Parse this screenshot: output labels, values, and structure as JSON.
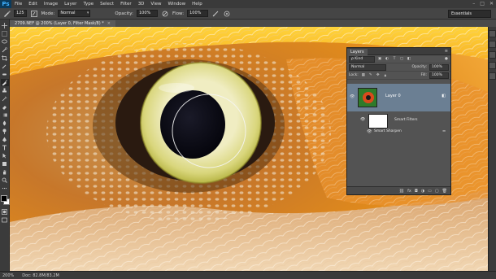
{
  "app": {
    "logo": "Ps",
    "menu": [
      "File",
      "Edit",
      "Image",
      "Layer",
      "Type",
      "Select",
      "Filter",
      "3D",
      "View",
      "Window",
      "Help"
    ],
    "window_controls": [
      "–",
      "□",
      "✕"
    ]
  },
  "options_bar": {
    "brush_size": "125",
    "mode_label": "Mode:",
    "mode_value": "Normal",
    "opacity_label": "Opacity:",
    "opacity_value": "100%",
    "flow_label": "Flow:",
    "flow_value": "100%",
    "workspace": "Essentials"
  },
  "document": {
    "tab_title": "2709.NEF @ 200% (Layer 0, Filter Mask/8) *",
    "close": "×"
  },
  "status_bar": {
    "zoom": "200%",
    "doc_info": "Doc: 82.8M/83.2M"
  },
  "layers_panel": {
    "tab": "Layers",
    "menu_icon": "≡",
    "filter_kind": "ρ Kind",
    "blend_mode": "Normal",
    "opacity_label": "Opacity:",
    "opacity_value": "100%",
    "lock_label": "Lock:",
    "fill_label": "Fill:",
    "fill_value": "100%",
    "layer_name": "Layer 0",
    "smart_filters_label": "Smart Filters",
    "filter_name": "Smart Sharpen",
    "footer_icons": [
      "link-icon",
      "fx-icon",
      "mask-icon",
      "adjustment-icon",
      "folder-icon",
      "new-layer-icon",
      "trash-icon"
    ]
  },
  "tools": [
    "move",
    "marquee",
    "lasso",
    "quick-select",
    "crop",
    "eyedropper",
    "healing",
    "brush",
    "clone",
    "history",
    "eraser",
    "gradient",
    "blur",
    "dodge",
    "pen",
    "type",
    "path-select",
    "shape",
    "hand",
    "zoom"
  ]
}
